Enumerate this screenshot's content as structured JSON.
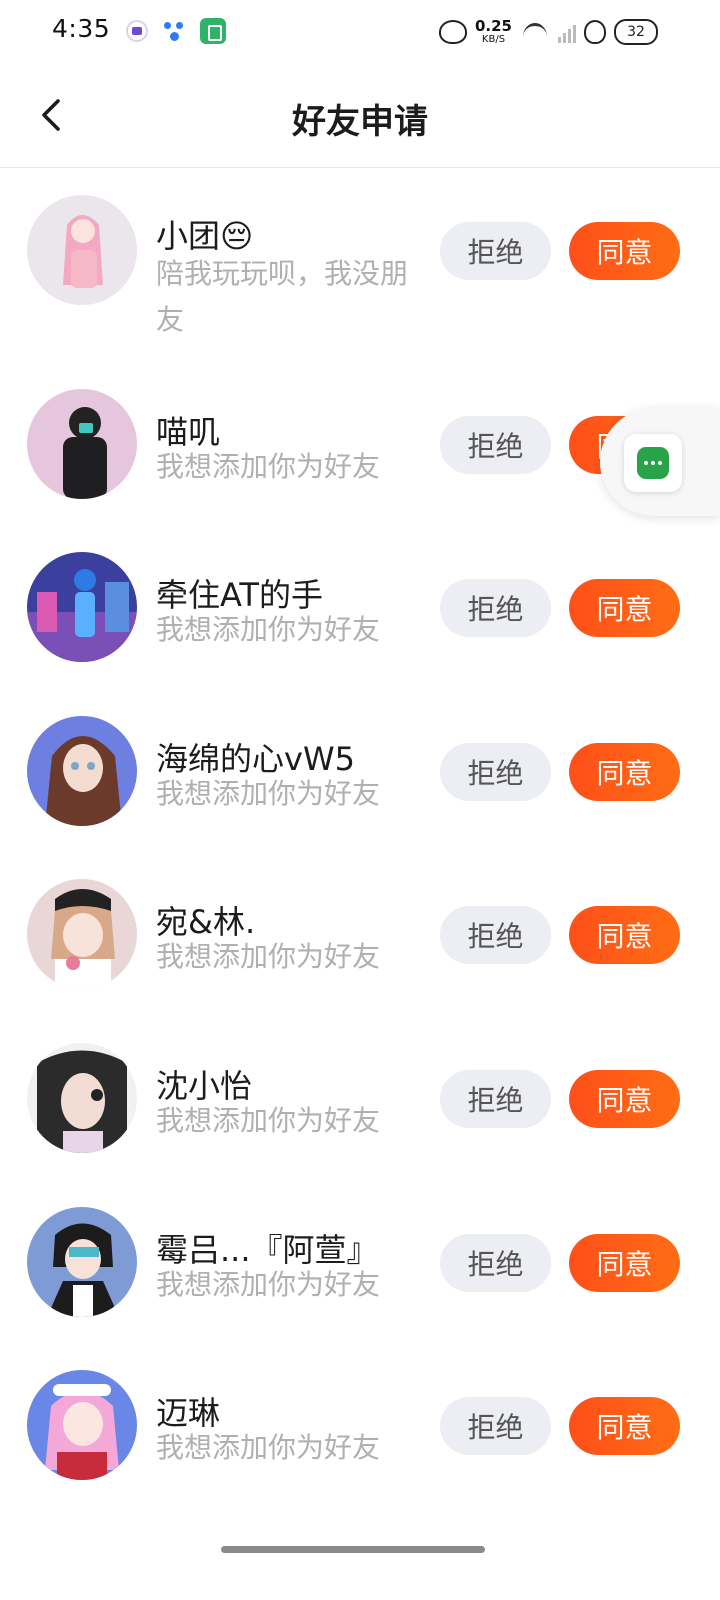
{
  "status_bar": {
    "time": "4:35",
    "net_speed_value": "0.25",
    "net_speed_unit": "KB/S",
    "battery": "32"
  },
  "header": {
    "title": "好友申请"
  },
  "requests": [
    {
      "name": "小团😔",
      "message": "陪我玩玩呗，我没朋友",
      "reject_label": "拒绝",
      "accept_label": "同意"
    },
    {
      "name": "喵叽",
      "message": "我想添加你为好友",
      "reject_label": "拒绝",
      "accept_label": "同意"
    },
    {
      "name": "牵住AT的手",
      "message": "我想添加你为好友",
      "reject_label": "拒绝",
      "accept_label": "同意"
    },
    {
      "name": "海绵的心vW5",
      "message": "我想添加你为好友",
      "reject_label": "拒绝",
      "accept_label": "同意"
    },
    {
      "name": "宛&林.",
      "message": "我想添加你为好友",
      "reject_label": "拒绝",
      "accept_label": "同意"
    },
    {
      "name": "沈小怡",
      "message": "我想添加你为好友",
      "reject_label": "拒绝",
      "accept_label": "同意"
    },
    {
      "name": "霉吕...『阿萱』",
      "message": "我想添加你为好友",
      "reject_label": "拒绝",
      "accept_label": "同意"
    },
    {
      "name": "迈琳",
      "message": "我想添加你为好友",
      "reject_label": "拒绝",
      "accept_label": "同意"
    }
  ],
  "colors": {
    "accept": "#ff5a17",
    "reject_bg": "#eceef3",
    "secondary_text": "#b0b0b0"
  }
}
